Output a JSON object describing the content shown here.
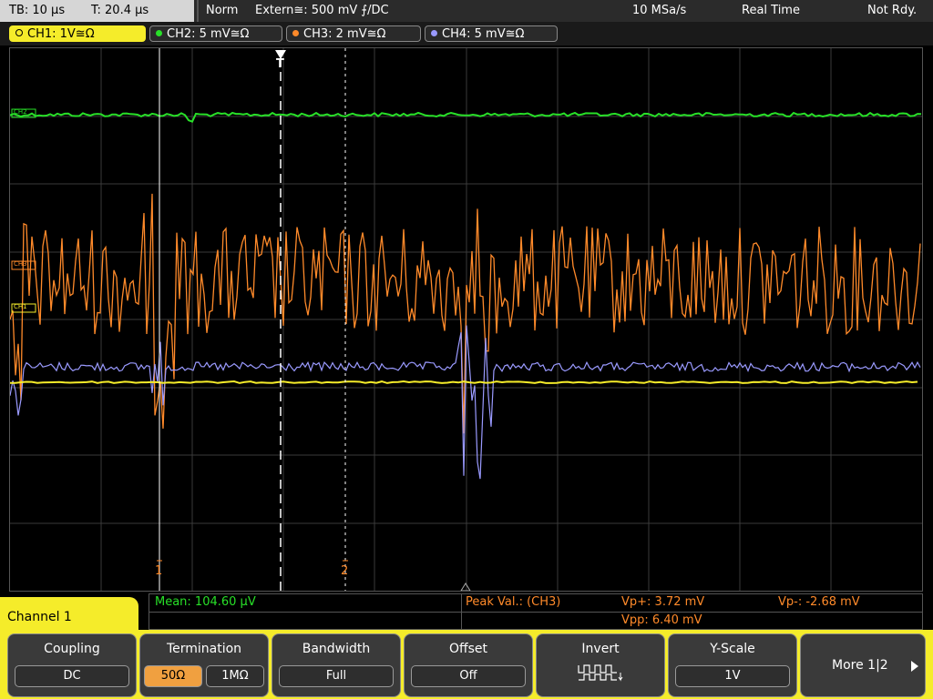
{
  "status_bar": {
    "timebase": "TB: 10 µs",
    "trigger_time": "T: 20.4 µs",
    "trigger_mode": "Norm",
    "trigger_source": "Extern≅: 500 mV ⨍/DC",
    "sample_rate": "10 MSa/s",
    "acq_mode": "Real Time",
    "acq_status": "Not Rdy."
  },
  "channel_tabs": [
    {
      "label": "CH1: 1V≅Ω",
      "color": "#f5ec2a",
      "active": true
    },
    {
      "label": "CH2: 5 mV≅Ω",
      "color": "#28e028",
      "active": false
    },
    {
      "label": "CH3: 2 mV≅Ω",
      "color": "#ff8a2a",
      "active": false
    },
    {
      "label": "CH4: 5 mV≅Ω",
      "color": "#9a9aff",
      "active": false
    }
  ],
  "markers": {
    "cursor1": "1",
    "cursor2": "2",
    "trigger": "T",
    "ch2_tag": "CH2",
    "ch3_tag": "CH3",
    "ch1_tag": "CH1"
  },
  "measurements": {
    "mean": "Mean: 104.60 µV",
    "peak_label": "Peak Val.: (CH3)",
    "vp_plus": "Vp+: 3.72 mV",
    "vp_minus": "Vp-: -2.68 mV",
    "vpp": "Vpp: 6.40 mV"
  },
  "channel_label": "Channel 1",
  "softkeys": {
    "coupling": {
      "label": "Coupling",
      "value": "DC"
    },
    "termination": {
      "label": "Termination",
      "option_a": "50Ω",
      "option_b": "1MΩ"
    },
    "bandwidth": {
      "label": "Bandwidth",
      "value": "Full"
    },
    "offset": {
      "label": "Offset",
      "value": "Off"
    },
    "invert": {
      "label": "Invert"
    },
    "yscale": {
      "label": "Y-Scale",
      "value": "1V"
    },
    "more": {
      "label": "More 1|2"
    }
  },
  "colors": {
    "ch1": "#f5ec2a",
    "ch2": "#28e028",
    "ch3": "#ff8a2a",
    "ch4": "#9a9aff",
    "selected_option": "#f0a040"
  }
}
